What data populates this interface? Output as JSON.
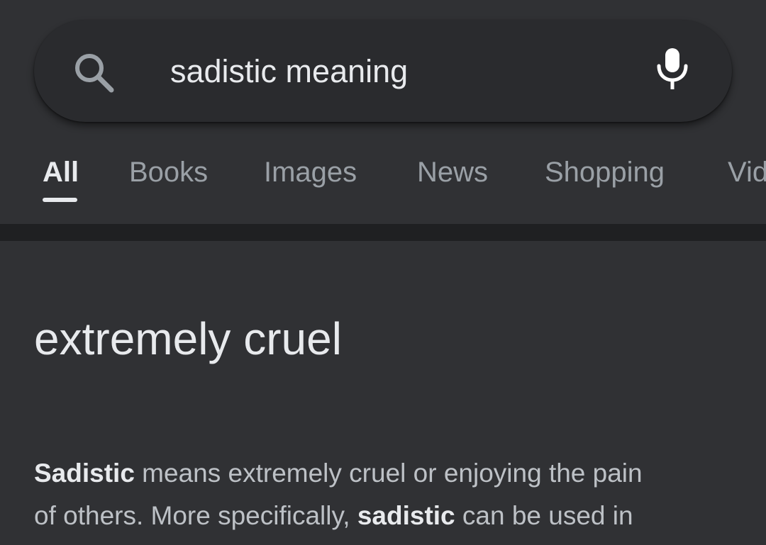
{
  "search": {
    "query": "sadistic meaning"
  },
  "tabs": [
    {
      "label": "All",
      "active": true
    },
    {
      "label": "Books",
      "active": false
    },
    {
      "label": "Images",
      "active": false
    },
    {
      "label": "News",
      "active": false
    },
    {
      "label": "Shopping",
      "active": false
    },
    {
      "label": "Vid",
      "active": false
    }
  ],
  "result": {
    "short_answer": "extremely cruel",
    "definition": {
      "term1": "Sadistic",
      "text1": " means extremely cruel or enjoying the pain",
      "text2": "of others. More specifically, ",
      "term2": "sadistic",
      "text3": " can be used in"
    }
  },
  "colors": {
    "background": "#303134",
    "search_bar": "#2a2b2e",
    "divider": "#1f2022",
    "text_primary": "#e8eaed",
    "text_secondary": "#9aa0a6"
  },
  "icons": {
    "search": "search-icon",
    "mic": "mic-icon"
  }
}
